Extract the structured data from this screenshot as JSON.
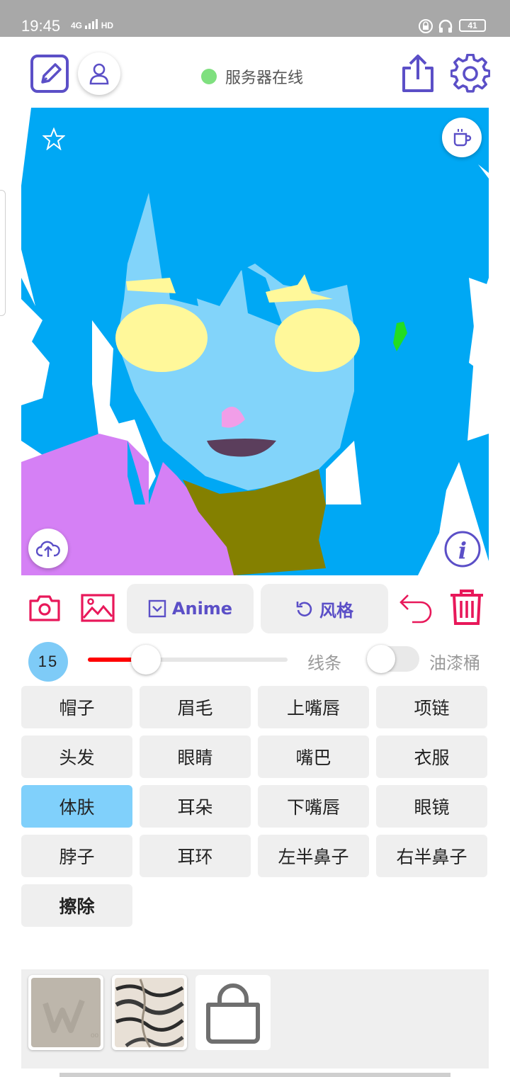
{
  "status": {
    "time": "19:45",
    "network": "4G",
    "hd": "HD",
    "battery": "41"
  },
  "header": {
    "server_status": "服务器在线",
    "server_color": "#7fe07f",
    "icons": [
      "edit-icon",
      "user-icon",
      "share-icon",
      "settings-icon"
    ],
    "accent": "#5b4fc7"
  },
  "canvas": {
    "icons": [
      "star-icon",
      "coffee-icon",
      "upload-cloud-icon",
      "info-icon"
    ]
  },
  "tools": {
    "anime_label": "Anime",
    "style_label": "风格",
    "icons": [
      "camera-icon",
      "image-icon",
      "undo-icon",
      "trash-icon"
    ],
    "danger_color": "#e8185a"
  },
  "brush": {
    "size": "15",
    "slider_fraction": 0.29,
    "line_label": "线条",
    "bucket_label": "油漆桶",
    "bucket_enabled": false
  },
  "parts": [
    {
      "label": "帽子",
      "active": false
    },
    {
      "label": "眉毛",
      "active": false
    },
    {
      "label": "上嘴唇",
      "active": false
    },
    {
      "label": "项链",
      "active": false
    },
    {
      "label": "头发",
      "active": false
    },
    {
      "label": "眼睛",
      "active": false
    },
    {
      "label": "嘴巴",
      "active": false
    },
    {
      "label": "衣服",
      "active": false
    },
    {
      "label": "体肤",
      "active": true
    },
    {
      "label": "耳朵",
      "active": false
    },
    {
      "label": "下嘴唇",
      "active": false
    },
    {
      "label": "眼镜",
      "active": false
    },
    {
      "label": "脖子",
      "active": false
    },
    {
      "label": "耳环",
      "active": false
    },
    {
      "label": "左半鼻子",
      "active": false
    },
    {
      "label": "右半鼻子",
      "active": false
    },
    {
      "label": "擦除",
      "active": false
    }
  ],
  "style_thumbs": {
    "icons": [
      "watermark-style-thumb",
      "zebra-style-thumb",
      "shop-bag-icon"
    ]
  }
}
